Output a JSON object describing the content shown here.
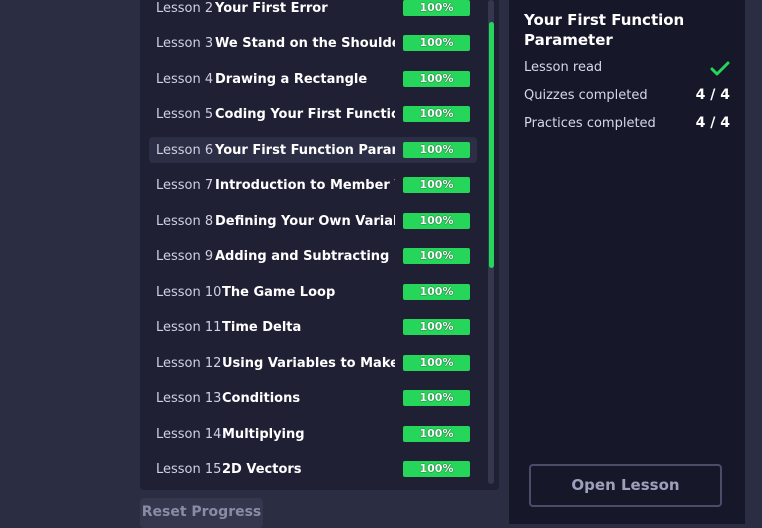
{
  "lessons": [
    {
      "number": "Lesson 2",
      "title": "Your First Error",
      "progress": "100%"
    },
    {
      "number": "Lesson 3",
      "title": "We Stand on the Shoulders of",
      "progress": "100%"
    },
    {
      "number": "Lesson 4",
      "title": "Drawing a Rectangle",
      "progress": "100%"
    },
    {
      "number": "Lesson 5",
      "title": "Coding Your First Function",
      "progress": "100%"
    },
    {
      "number": "Lesson 6",
      "title": "Your First Function Paramete",
      "progress": "100%"
    },
    {
      "number": "Lesson 7",
      "title": "Introduction to Member Vari",
      "progress": "100%"
    },
    {
      "number": "Lesson 8",
      "title": "Defining Your Own Variables",
      "progress": "100%"
    },
    {
      "number": "Lesson 9",
      "title": "Adding and Subtracting",
      "progress": "100%"
    },
    {
      "number": "Lesson 10",
      "title": "The Game Loop",
      "progress": "100%"
    },
    {
      "number": "Lesson 11",
      "title": "Time Delta",
      "progress": "100%"
    },
    {
      "number": "Lesson 12",
      "title": "Using Variables to Make Coc",
      "progress": "100%"
    },
    {
      "number": "Lesson 13",
      "title": "Conditions",
      "progress": "100%"
    },
    {
      "number": "Lesson 14",
      "title": "Multiplying",
      "progress": "100%"
    },
    {
      "number": "Lesson 15",
      "title": "2D Vectors",
      "progress": "100%"
    }
  ],
  "reset_button": "Reset Progress",
  "detail": {
    "title": "Your First Function Parameter",
    "lesson_read_label": "Lesson read",
    "quizzes_label": "Quizzes completed",
    "quizzes_value": "4 / 4",
    "practices_label": "Practices completed",
    "practices_value": "4 / 4",
    "open_button": "Open Lesson"
  },
  "colors": {
    "accent": "#26d65a",
    "panel": "#1f2034",
    "background": "#2b2d42"
  }
}
